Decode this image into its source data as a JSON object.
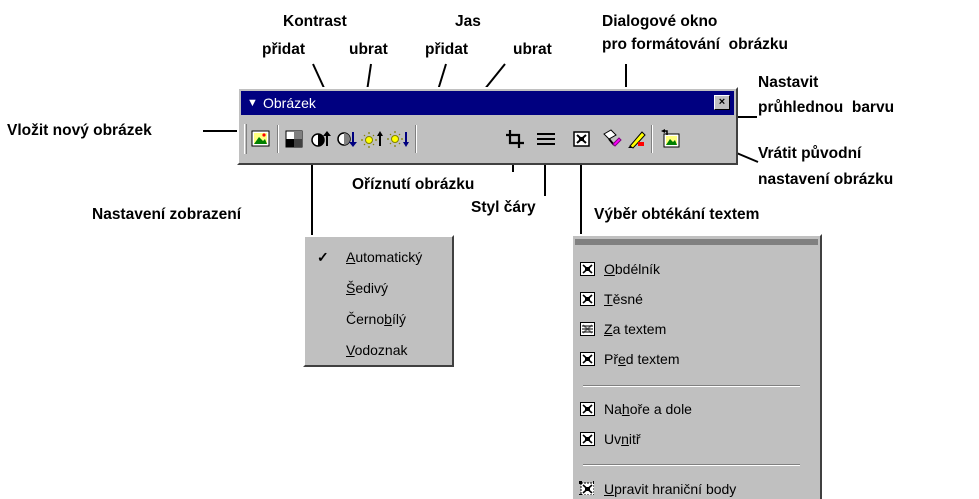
{
  "toolbar": {
    "title": "Obrázek",
    "close_label": "×",
    "buttons": [
      {
        "name": "vlozit-obrazek",
        "icon": "insert-picture-icon"
      },
      {
        "name": "nastaveni-zobrazeni",
        "icon": "image-control-icon"
      },
      {
        "name": "pridat-kontrast",
        "icon": "more-contrast-icon"
      },
      {
        "name": "ubrat-kontrast",
        "icon": "less-contrast-icon"
      },
      {
        "name": "pridat-jas",
        "icon": "more-brightness-icon"
      },
      {
        "name": "ubrat-jas",
        "icon": "less-brightness-icon"
      },
      {
        "name": "oriznuti",
        "icon": "crop-icon"
      },
      {
        "name": "styl-cary",
        "icon": "line-style-icon"
      },
      {
        "name": "obtekani",
        "icon": "text-wrapping-icon"
      },
      {
        "name": "format-obrazku",
        "icon": "format-picture-icon"
      },
      {
        "name": "pruhledna-barva",
        "icon": "set-transparent-color-icon"
      },
      {
        "name": "vratit-nastaveni",
        "icon": "reset-picture-icon"
      }
    ]
  },
  "labels": {
    "kontrast": "Kontrast",
    "kontrast_pridat": "přidat",
    "kontrast_ubrat": "ubrat",
    "jas": "Jas",
    "jas_pridat": "přidat",
    "jas_ubrat": "ubrat",
    "dialog_line1": "Dialogové okno",
    "dialog_line2": "pro formátování  obrázku",
    "nastavit_line1": "Nastavit",
    "nastavit_line2": "průhlednou  barvu",
    "vlozit": "Vložit nový obrázek",
    "vratit_line1": "Vrátit původní",
    "vratit_line2": "nastavení obrázku",
    "oriznuti": "Oříznutí obrázku",
    "styl_cary": "Styl čáry",
    "nastaveni_zobrazeni": "Nastavení zobrazení",
    "vyber_obtekani": "Výběr obtékání textem"
  },
  "image_menu": {
    "items": [
      {
        "pre": "",
        "key": "A",
        "post": "utomatický",
        "checked": true
      },
      {
        "pre": "",
        "key": "Š",
        "post": "edivý",
        "checked": false
      },
      {
        "pre": "Černo",
        "key": "b",
        "post": "ílý",
        "checked": false
      },
      {
        "pre": "",
        "key": "V",
        "post": "odoznak",
        "checked": false
      }
    ],
    "check_mark": "✓"
  },
  "wrap_menu": {
    "items": [
      {
        "pre": "",
        "key": "O",
        "post": "bdélník",
        "icon": "wrap-square-icon"
      },
      {
        "pre": "",
        "key": "T",
        "post": "ěsné",
        "icon": "wrap-tight-icon"
      },
      {
        "pre": "",
        "key": "Z",
        "post": "a textem",
        "icon": "wrap-behind-text-icon"
      },
      {
        "pre": "Př",
        "key": "e",
        "post": "d textem",
        "icon": "wrap-in-front-icon"
      },
      {
        "pre": "Na",
        "key": "h",
        "post": "oře a dole",
        "icon": "wrap-top-bottom-icon"
      },
      {
        "pre": "Uv",
        "key": "n",
        "post": "itř",
        "icon": "wrap-through-icon"
      },
      {
        "pre": "",
        "key": "U",
        "post": "pravit hraniční body",
        "icon": "edit-wrap-points-icon"
      }
    ]
  }
}
